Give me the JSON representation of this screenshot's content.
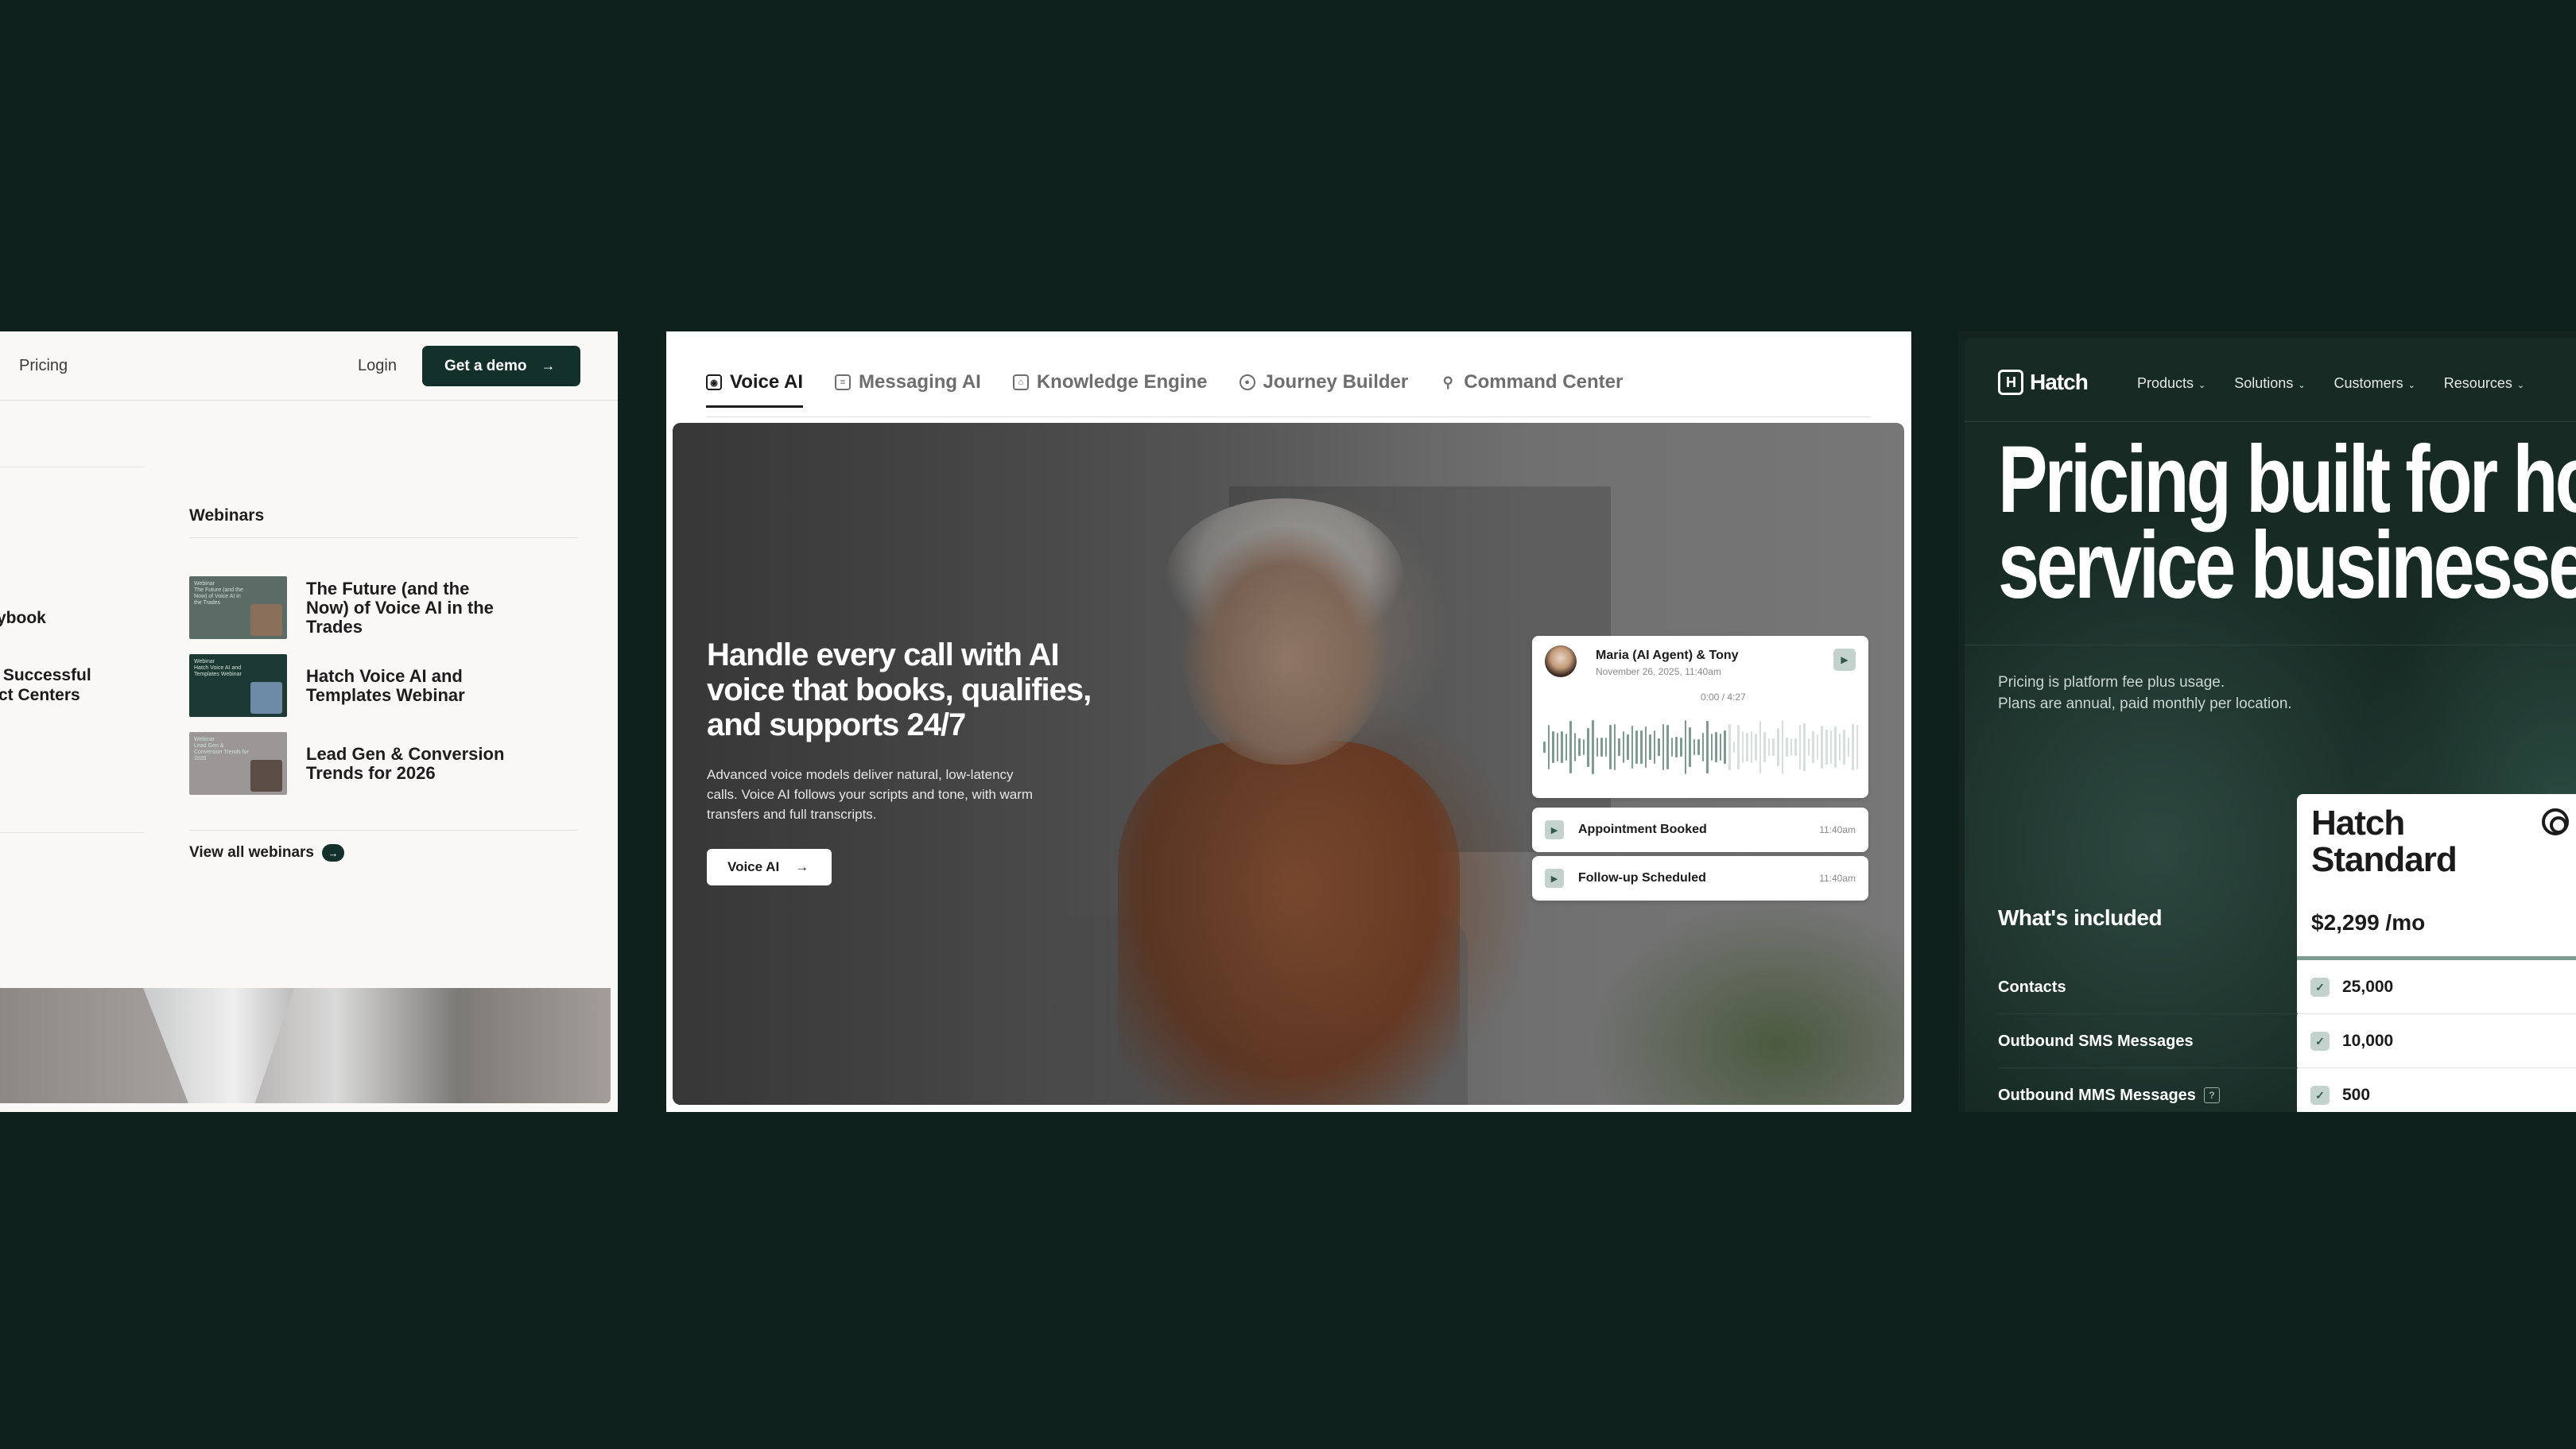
{
  "left_panel": {
    "nav_pricing": "Pricing",
    "nav_login": "Login",
    "cta_label": "Get a demo",
    "cut_text_1": "ybook",
    "cut_text_2": " Successful\nct Centers",
    "webinars_heading": "Webinars",
    "webinars": [
      {
        "title": "The Future (and the Now) of Voice AI in the Trades",
        "thumb_text": "Webinar\nThe Future (and the Now) of Voice AI in the Trades",
        "thumb_color": "#5b6b66"
      },
      {
        "title": "Hatch Voice AI and Templates Webinar",
        "thumb_text": "Webinar\nHatch Voice AI and Templates Webinar",
        "thumb_color": "#1c3a33"
      },
      {
        "title": "Lead Gen & Conversion Trends for 2026",
        "thumb_text": "Webinar\nLead Gen & Conversion Trends for 2026",
        "thumb_color": "#9a9796"
      }
    ],
    "view_all": "View all webinars"
  },
  "middle_panel": {
    "tabs": [
      {
        "label": "Voice AI",
        "icon": "voice-ai-icon",
        "active": true
      },
      {
        "label": "Messaging AI",
        "icon": "messaging-icon",
        "active": false
      },
      {
        "label": "Knowledge Engine",
        "icon": "knowledge-icon",
        "active": false
      },
      {
        "label": "Journey Builder",
        "icon": "journey-icon",
        "active": false
      },
      {
        "label": "Command Center",
        "icon": "command-center-icon",
        "active": false
      }
    ],
    "headline": "Handle every call with AI voice that books, qualifies, and supports 24/7",
    "subtext": "Advanced voice models deliver natural, low-latency calls. Voice AI follows your scripts and tone, with warm transfers and full transcripts.",
    "button_label": "Voice AI",
    "call_card": {
      "name": "Maria (AI Agent) & Tony",
      "date": "November 26, 2025, 11:40am",
      "time": "0:00 / 4:27",
      "played_fraction": 0.58
    },
    "events": [
      {
        "label": "Appointment Booked",
        "time": "11:40am"
      },
      {
        "label": "Follow-up Scheduled",
        "time": "11:40am"
      }
    ]
  },
  "right_panel": {
    "brand": "Hatch",
    "nav": [
      "Products",
      "Solutions",
      "Customers",
      "Resources"
    ],
    "headline": "Pricing built for ho\nservice businesse",
    "description_1": "Pricing is platform fee plus usage.",
    "description_2": "Plans are annual, paid monthly per location.",
    "plan_name": "Hatch\nStandard",
    "plan_price": "$2,299 /mo",
    "included_heading": "What's included",
    "rows": [
      {
        "label": "Contacts",
        "value": "25,000",
        "help": false
      },
      {
        "label": "Outbound SMS Messages",
        "value": "10,000",
        "help": false
      },
      {
        "label": "Outbound MMS Messages",
        "value": "500",
        "help": true
      }
    ]
  },
  "colors": {
    "background": "#0f211d",
    "brand_dark": "#14302a",
    "accent_sage": "#7f9b91"
  }
}
